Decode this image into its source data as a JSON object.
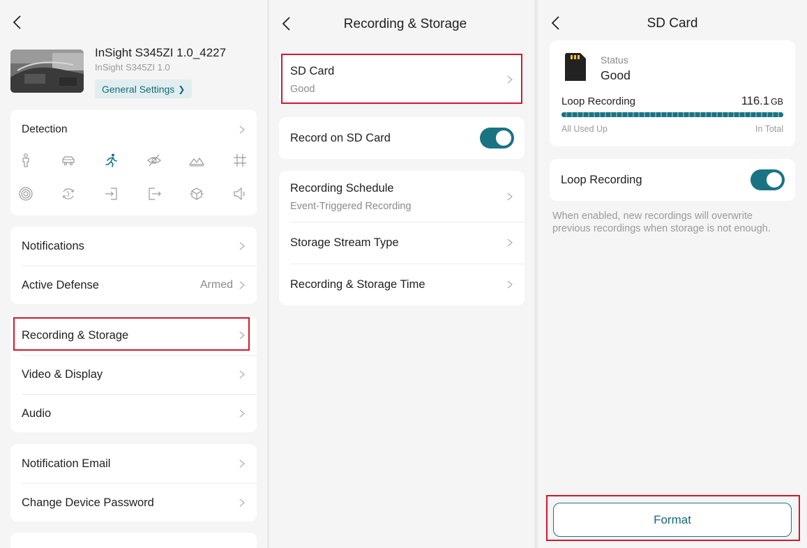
{
  "colors": {
    "accent": "#1a7383",
    "highlight": "#d3172b",
    "background": "#f5f5f5"
  },
  "screen1": {
    "device_name": "InSight S345ZI 1.0_4227",
    "device_model": "InSight S345ZI 1.0",
    "general_settings": "General Settings",
    "general_settings_chevron": "❯",
    "detection_label": "Detection",
    "detection_icons": [
      "person-icon",
      "vehicle-icon",
      "motion-icon",
      "tamper-icon",
      "area-intrusion-icon",
      "line-crossing-icon",
      "sound-detection-icon",
      "scene-change-icon",
      "region-entering-icon",
      "region-exiting-icon",
      "object-left-icon",
      "audio-exception-icon"
    ],
    "notifications": "Notifications",
    "active_defense": "Active Defense",
    "active_defense_value": "Armed",
    "recording_storage": "Recording & Storage",
    "video_display": "Video & Display",
    "audio": "Audio",
    "notification_email": "Notification Email",
    "change_password": "Change Device Password"
  },
  "screen2": {
    "title": "Recording & Storage",
    "sd_card": "SD Card",
    "sd_card_status": "Good",
    "record_on_sd": "Record on SD Card",
    "record_on_sd_enabled": true,
    "recording_schedule": "Recording Schedule",
    "recording_schedule_value": "Event-Triggered Recording",
    "storage_stream_type": "Storage Stream Type",
    "recording_storage_time": "Recording & Storage Time"
  },
  "screen3": {
    "title": "SD Card",
    "status_label": "Status",
    "status_value": "Good",
    "loop_recording_label": "Loop Recording",
    "capacity": "116.1",
    "capacity_unit": "GB",
    "used_fraction": 1.0,
    "all_used_up": "All Used Up",
    "in_total": "In Total",
    "loop_toggle_label": "Loop Recording",
    "loop_enabled": true,
    "loop_description": "When enabled, new recordings will overwrite previous recordings when storage is not enough.",
    "format_button": "Format"
  }
}
